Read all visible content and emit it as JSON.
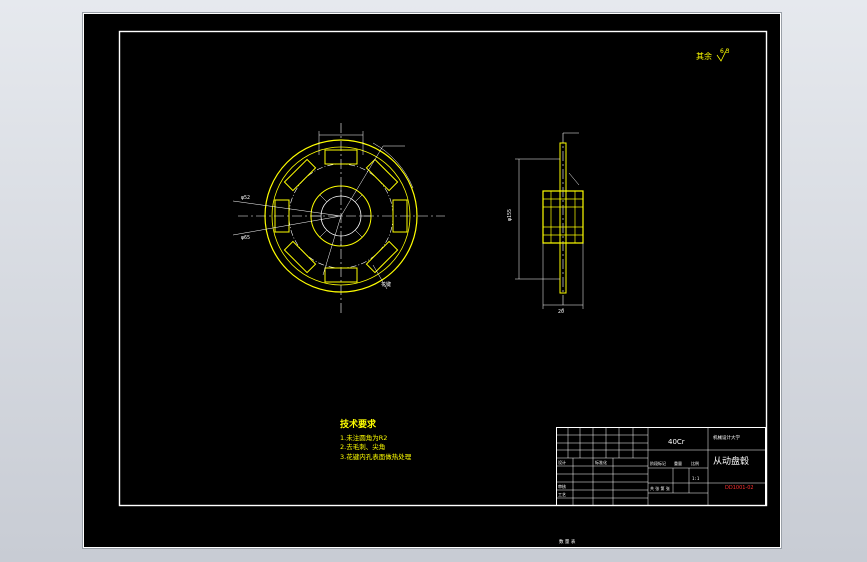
{
  "drawing": {
    "roughness_label": "其余",
    "roughness_value": "6.3",
    "tech_requirements": {
      "title": "技术要求",
      "items": [
        "1.未注圆角为R2",
        "2.去毛刺、尖角",
        "3.花键内孔表面做热处理"
      ]
    },
    "title_block": {
      "material": "40Cr",
      "university": "机械设计大学",
      "part_name": "从动盘毂",
      "drawing_no": "DD1001-02",
      "scale": "1:1",
      "row_labels": [
        "设计",
        "审核",
        "工艺"
      ],
      "col_labels": [
        "阶段标记",
        "重量",
        "比例"
      ],
      "sheet_text": "共 张 第 张",
      "standardization": "标准化"
    },
    "bottom_caption": "数 量 表",
    "front_view_labels": {
      "dim_a": "φ52",
      "dim_b": "φ65",
      "section": "花键"
    },
    "side_view_labels": {
      "dim_height": "φ155",
      "dim_width": "20"
    }
  },
  "colors": {
    "background": "#000000",
    "lines": "#ffffff",
    "accent": "#ffff00",
    "frame": "#c8ccd4",
    "title_red": "#ff3030"
  }
}
